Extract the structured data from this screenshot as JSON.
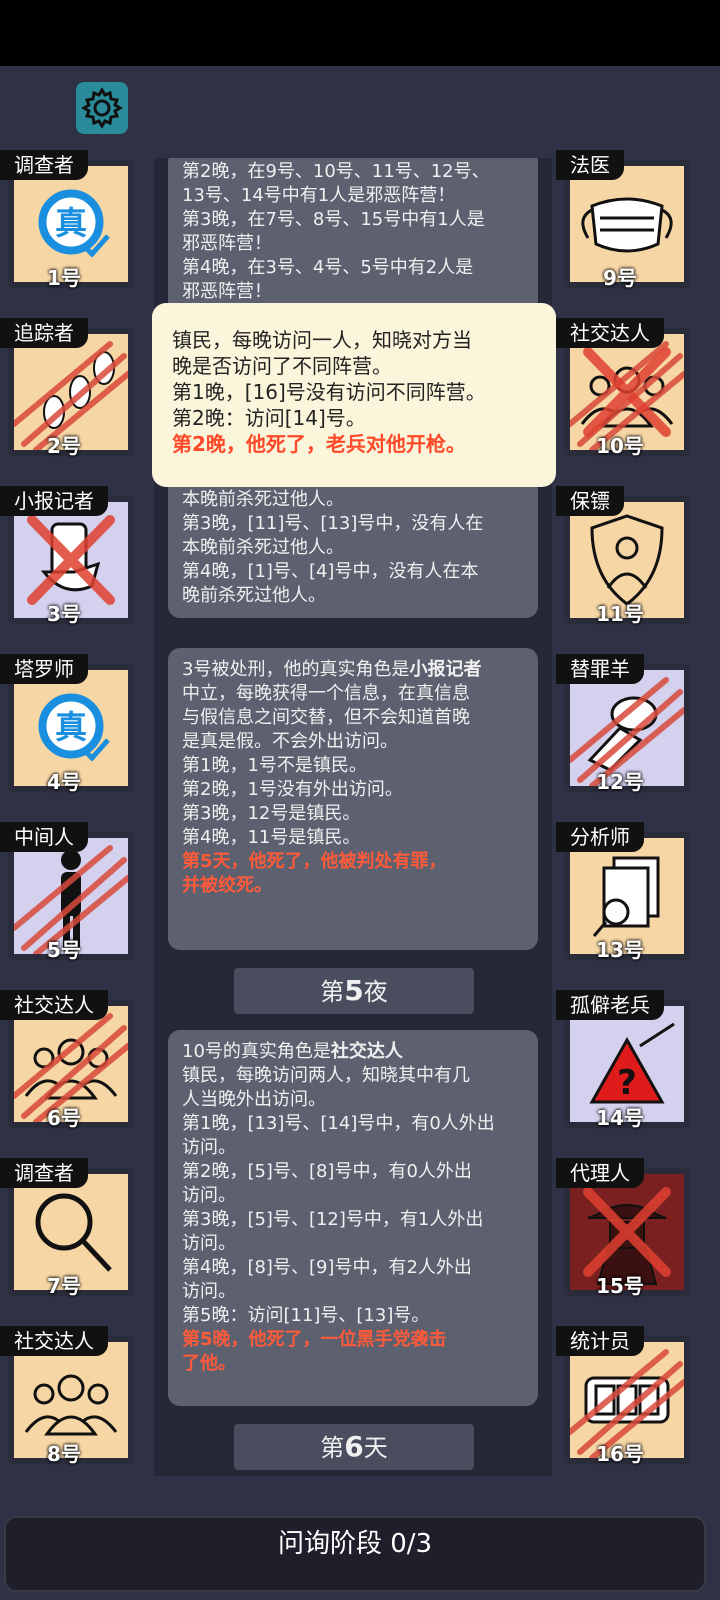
{
  "left_players": [
    {
      "role": "调查者",
      "num": "1号",
      "icon": "truth-badge-icon",
      "state": "alive",
      "bg": "tan"
    },
    {
      "role": "追踪者",
      "num": "2号",
      "icon": "footprints-icon",
      "state": "slashed",
      "bg": "tan"
    },
    {
      "role": "小报记者",
      "num": "3号",
      "icon": "scroll-hand-icon",
      "state": "crossed",
      "bg": "light"
    },
    {
      "role": "塔罗师",
      "num": "4号",
      "icon": "truth-badge-icon",
      "state": "alive",
      "bg": "tan"
    },
    {
      "role": "中间人",
      "num": "5号",
      "icon": "person-silhouette-icon",
      "state": "slashed",
      "bg": "light"
    },
    {
      "role": "社交达人",
      "num": "6号",
      "icon": "group-icon",
      "state": "slashed",
      "bg": "tan"
    },
    {
      "role": "调查者",
      "num": "7号",
      "icon": "magnifier-icon",
      "state": "alive",
      "bg": "tan"
    },
    {
      "role": "社交达人",
      "num": "8号",
      "icon": "group-icon",
      "state": "alive",
      "bg": "tan"
    }
  ],
  "right_players": [
    {
      "role": "法医",
      "num": "9号",
      "icon": "mask-icon",
      "state": "alive",
      "bg": "tan"
    },
    {
      "role": "社交达人",
      "num": "10号",
      "icon": "group-icon",
      "state": "crossed-slashed",
      "bg": "tan"
    },
    {
      "role": "保镖",
      "num": "11号",
      "icon": "shield-person-icon",
      "state": "alive",
      "bg": "tan"
    },
    {
      "role": "替罪羊",
      "num": "12号",
      "icon": "goat-icon",
      "state": "slashed",
      "bg": "light"
    },
    {
      "role": "分析师",
      "num": "13号",
      "icon": "documents-search-icon",
      "state": "alive",
      "bg": "tan"
    },
    {
      "role": "孤僻老兵",
      "num": "14号",
      "icon": "warning-rifle-icon",
      "state": "alive",
      "bg": "light"
    },
    {
      "role": "代理人",
      "num": "15号",
      "icon": "hat-spy-icon",
      "state": "crossed",
      "bg": "dark"
    },
    {
      "role": "统计员",
      "num": "16号",
      "icon": "counter-icon",
      "state": "slashed",
      "bg": "tan"
    }
  ],
  "log": {
    "card1": [
      "第2晚，在9号、10号、11号、12号、",
      "13号、14号中有1人是邪恶阵营！",
      "第3晚，在7号、8号、15号中有1人是",
      "邪恶阵营！",
      "第4晚，在3号、4号、5号中有2人是",
      "邪恶阵营！"
    ],
    "card2": [
      "本晚前杀死过他人。",
      "第3晚，[11]号、[13]号中，没有人在",
      "本晚前杀死过他人。",
      "第4晚，[1]号、[4]号中，没有人在本",
      "晚前杀死过他人。"
    ],
    "card3_intro": "3号被处刑，他的真实角色是",
    "card3_role": "小报记者",
    "card3_lines": [
      "中立，每晚获得一个信息，在真信息",
      "与假信息之间交替，但不会知道首晚",
      "是真是假。不会外出访问。",
      "第1晚，1号不是镇民。",
      "第2晚，1号没有外出访问。",
      "第3晚，12号是镇民。",
      "第4晚，11号是镇民。"
    ],
    "card3_death": [
      "第5天，他死了，他被判处有罪，",
      "并被绞死。"
    ],
    "marker1_pre": "第",
    "marker1_num": "5",
    "marker1_post": "夜",
    "card4_intro": "10号的真实角色是",
    "card4_role": "社交达人",
    "card4_lines": [
      "镇民，每晚访问两人，知晓其中有几",
      "人当晚外出访问。",
      "第1晚，[13]号、[14]号中，有0人外出",
      "访问。",
      "第2晚，[5]号、[8]号中，有0人外出",
      "访问。",
      "第3晚，[5]号、[12]号中，有1人外出",
      "访问。",
      "第4晚，[8]号、[9]号中，有2人外出",
      "访问。",
      "第5晚：访问[11]号、[13]号。"
    ],
    "card4_death": [
      "第5晚，他死了，一位黑手党袭击",
      "了他。"
    ],
    "marker2_pre": "第",
    "marker2_num": "6",
    "marker2_post": "天"
  },
  "popup": {
    "lines": [
      "镇民，每晚访问一人，知晓对方当",
      "晚是否访问了不同阵营。",
      "第1晚，[16]号没有访问不同阵营。",
      "第2晚：访问[14]号。"
    ],
    "death": "第2晚，他死了，老兵对他开枪。"
  },
  "phase_label": "问询阶段 0/3",
  "colors": {
    "accent": "#2a8b9a",
    "death_text": "#ff5a3a",
    "tile_bg": "#f6d6a4",
    "slash": "#d84a3a"
  }
}
